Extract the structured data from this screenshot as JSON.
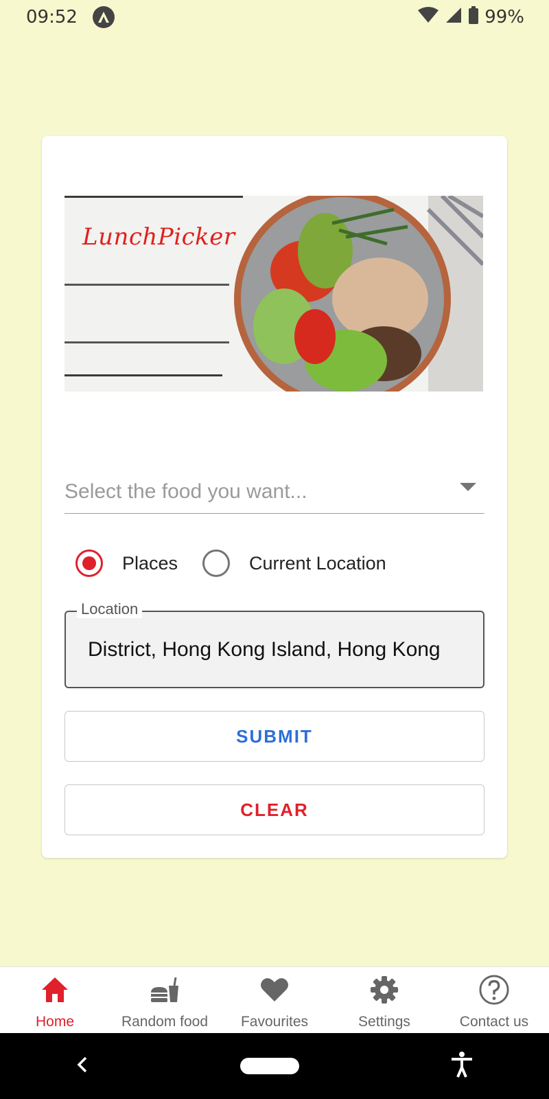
{
  "status_bar": {
    "time": "09:52",
    "battery": "99%",
    "icons": [
      "app-icon",
      "wifi-icon",
      "signal-icon",
      "battery-icon"
    ]
  },
  "banner": {
    "logo_text": "LunchPicker"
  },
  "form": {
    "food_select": {
      "placeholder": "Select the food you want..."
    },
    "radio_options": [
      {
        "label": "Places",
        "checked": true
      },
      {
        "label": "Current Location",
        "checked": false
      }
    ],
    "location": {
      "label": "Location",
      "value": "District, Hong Kong Island, Hong Kong"
    },
    "submit_label": "SUBMIT",
    "clear_label": "CLEAR"
  },
  "bottom_nav": {
    "items": [
      {
        "label": "Home",
        "icon": "home-icon",
        "active": true
      },
      {
        "label": "Random food",
        "icon": "burger-drink-icon",
        "active": false
      },
      {
        "label": "Favourites",
        "icon": "heart-icon",
        "active": false
      },
      {
        "label": "Settings",
        "icon": "gear-icon",
        "active": false
      },
      {
        "label": "Contact us",
        "icon": "help-circle-icon",
        "active": false
      }
    ]
  },
  "colors": {
    "background": "#f8f8cf",
    "accent_red": "#e0202b",
    "accent_blue": "#2c6fd8"
  }
}
